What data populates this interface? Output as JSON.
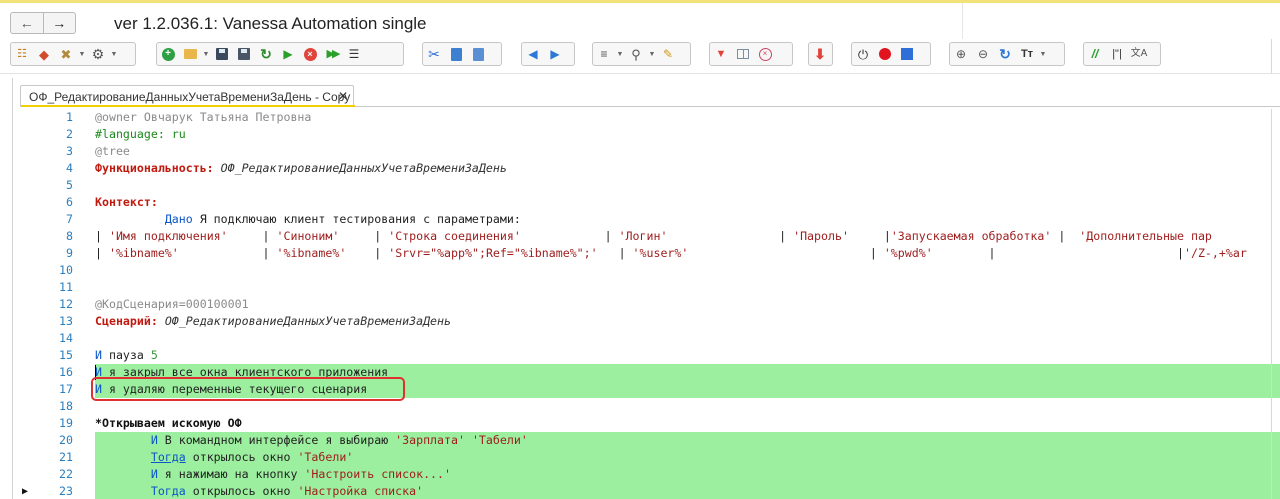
{
  "window": {
    "title": "ver 1.2.036.1: Vanessa Automation single",
    "nav_back_icon": "arrow-left-icon",
    "nav_forward_icon": "arrow-right-icon"
  },
  "colors": {
    "highlight_green": "#9cef9f",
    "keyword_red": "#c0190e",
    "line_number_blue": "#2b7fbf",
    "tab_accent_yellow": "#f0d000",
    "annotation_red": "#e03030"
  },
  "toolbar": {
    "groups": [
      [
        "tree-icon",
        "feature-icon",
        "tools-icon",
        "settings-gear-icon"
      ],
      [
        "add-icon",
        "open-folder-icon",
        "save-icon",
        "save-as-icon",
        "refresh-icon",
        "run-icon",
        "stop-icon",
        "run-all-icon",
        "steps-icon"
      ],
      [
        "cut-icon",
        "copy-icon",
        "paste-icon"
      ],
      [
        "arrow-left-icon",
        "arrow-right-icon"
      ],
      [
        "list-icon",
        "search-icon",
        "brush-icon"
      ],
      [
        "heart-icon",
        "table-icon",
        "clear-icon"
      ],
      [
        "arrow-down-icon"
      ],
      [
        "power-icon",
        "record-icon",
        "stop-square-icon"
      ],
      [
        "zoom-in-icon",
        "zoom-out-icon",
        "sync-icon",
        "font-icon"
      ],
      [
        "comment-icon",
        "quotes-icon",
        "translate-icon"
      ]
    ],
    "quotes_glyph": "|\"|",
    "comment_glyph": "//",
    "translate_glyph": "文A",
    "font_glyph": "Тт"
  },
  "tab": {
    "label": "ОФ_РедактированиеДанныхУчетаВремениЗаДень - Copy",
    "close_glyph": "✕"
  },
  "editor": {
    "lines": [
      {
        "n": "1",
        "segments": [
          {
            "t": "@owner Овчарук Татьяна Петровна",
            "c": "gray"
          }
        ]
      },
      {
        "n": "2",
        "segments": [
          {
            "t": "#language: ru",
            "c": "green"
          }
        ]
      },
      {
        "n": "3",
        "segments": [
          {
            "t": "@tree",
            "c": "gray"
          }
        ]
      },
      {
        "n": "4",
        "segments": [
          {
            "t": "Функциональность: ",
            "c": "key"
          },
          {
            "t": "ОФ_РедактированиеДанныхУчетаВремениЗаДень",
            "c": "it"
          }
        ]
      },
      {
        "n": "5",
        "segments": []
      },
      {
        "n": "6",
        "segments": [
          {
            "t": "Контекст:",
            "c": "key"
          }
        ]
      },
      {
        "n": "7",
        "segments": [
          {
            "t": "\t  ",
            "c": "text"
          },
          {
            "t": "Дано",
            "c": "blue"
          },
          {
            "t": " Я подключаю клиент тестирования с параметрами:",
            "c": "text"
          }
        ]
      },
      {
        "n": "8",
        "segments": [
          {
            "t": "| ",
            "c": "text"
          },
          {
            "t": "'Имя подключения'",
            "c": "str"
          },
          {
            "t": "     | ",
            "c": "text"
          },
          {
            "t": "'Синоним'",
            "c": "str"
          },
          {
            "t": "     | ",
            "c": "text"
          },
          {
            "t": "'Строка соединения'",
            "c": "str"
          },
          {
            "t": "            | ",
            "c": "text"
          },
          {
            "t": "'Логин'",
            "c": "str"
          },
          {
            "t": "                | ",
            "c": "text"
          },
          {
            "t": "'Пароль'",
            "c": "str"
          },
          {
            "t": "     |",
            "c": "text"
          },
          {
            "t": "'Запускаемая обработка'",
            "c": "str"
          },
          {
            "t": " |  ",
            "c": "text"
          },
          {
            "t": "'Дополнительные пар",
            "c": "str"
          }
        ]
      },
      {
        "n": "9",
        "segments": [
          {
            "t": "| ",
            "c": "text"
          },
          {
            "t": "'%ibname%'",
            "c": "str"
          },
          {
            "t": "            | ",
            "c": "text"
          },
          {
            "t": "'%ibname%'",
            "c": "str"
          },
          {
            "t": "    | ",
            "c": "text"
          },
          {
            "t": "'Srvr=\"%app%\";Ref=\"%ibname%\";'",
            "c": "str"
          },
          {
            "t": "   | ",
            "c": "text"
          },
          {
            "t": "'%user%'",
            "c": "str"
          },
          {
            "t": "                          | ",
            "c": "text"
          },
          {
            "t": "'%pwd%'",
            "c": "str"
          },
          {
            "t": "        |                          |",
            "c": "text"
          },
          {
            "t": "'/Z-,+%ar",
            "c": "str"
          }
        ]
      },
      {
        "n": "10",
        "segments": []
      },
      {
        "n": "11",
        "segments": []
      },
      {
        "n": "12",
        "segments": [
          {
            "t": "@КодСценария=000100001",
            "c": "gray"
          }
        ]
      },
      {
        "n": "13",
        "segments": [
          {
            "t": "Сценарий: ",
            "c": "key"
          },
          {
            "t": "ОФ_РедактированиеДанныхУчетаВремениЗаДень",
            "c": "it"
          }
        ]
      },
      {
        "n": "14",
        "segments": []
      },
      {
        "n": "15",
        "segments": [
          {
            "t": "И",
            "c": "blue"
          },
          {
            "t": " пауза ",
            "c": "text"
          },
          {
            "t": "5",
            "c": "num"
          }
        ]
      },
      {
        "n": "16",
        "hl": true,
        "caret": true,
        "segments": [
          {
            "t": "И",
            "c": "blue"
          },
          {
            "t": " я закрыл все окна клиентского приложения",
            "c": "text"
          }
        ]
      },
      {
        "n": "17",
        "hl": true,
        "segments": [
          {
            "t": "И",
            "c": "blue"
          },
          {
            "t": " я удаляю переменные текущего сценария",
            "c": "text"
          }
        ]
      },
      {
        "n": "18",
        "segments": []
      },
      {
        "n": "19",
        "segments": [
          {
            "t": "*Открываем искомую ОФ",
            "c": "bold"
          }
        ]
      },
      {
        "n": "20",
        "hl": true,
        "segments": [
          {
            "t": "\t",
            "c": "text"
          },
          {
            "t": "И",
            "c": "blue"
          },
          {
            "t": " В командном интерфейсе я выбираю ",
            "c": "text"
          },
          {
            "t": "'Зарплата'",
            "c": "str"
          },
          {
            "t": " ",
            "c": "text"
          },
          {
            "t": "'Табели'",
            "c": "str"
          }
        ]
      },
      {
        "n": "21",
        "hl": true,
        "segments": [
          {
            "t": "\t",
            "c": "text"
          },
          {
            "t": "Тогда",
            "c": "link"
          },
          {
            "t": " открылось окно ",
            "c": "text"
          },
          {
            "t": "'Табели'",
            "c": "str"
          }
        ]
      },
      {
        "n": "22",
        "hl": true,
        "segments": [
          {
            "t": "\t",
            "c": "text"
          },
          {
            "t": "И",
            "c": "blue"
          },
          {
            "t": " я нажимаю на кнопку ",
            "c": "text"
          },
          {
            "t": "'Настроить список...'",
            "c": "str"
          }
        ]
      },
      {
        "n": "23",
        "hl": true,
        "marker": "▶",
        "segments": [
          {
            "t": "\t",
            "c": "text"
          },
          {
            "t": "Тогда",
            "c": "blue"
          },
          {
            "t": " открылось окно ",
            "c": "text"
          },
          {
            "t": "'Настройка списка'",
            "c": "str"
          }
        ]
      }
    ]
  }
}
